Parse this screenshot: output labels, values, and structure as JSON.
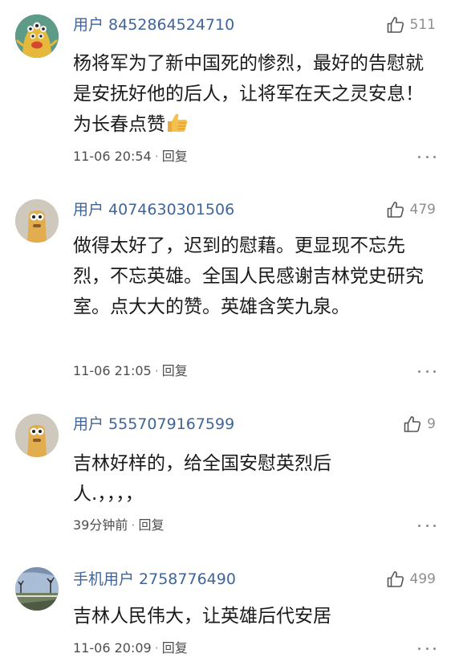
{
  "comments": [
    {
      "username": "用户 8452864524710",
      "likes": "511",
      "text": "杨将军为了新中国死的惨烈，最好的告慰就是安抚好他的后人，让将军在天之灵安息！为长春点赞",
      "time": "11-06 20:54",
      "separator": "·",
      "reply": "回复"
    },
    {
      "username": "用户 4074630301506",
      "likes": "479",
      "text": "做得太好了，迟到的慰藉。更显现不忘先烈，不忘英雄。全国人民感谢吉林党史研究室。点大大的赞。英雄含笑九泉。",
      "time": "11-06 21:05",
      "separator": "·",
      "reply": "回复"
    },
    {
      "username": "用户 5557079167599",
      "likes": "9",
      "text": "吉林好样的，给全国安慰英烈后人.，，，，",
      "time": "39分钟前",
      "separator": "·",
      "reply": "回复"
    },
    {
      "username": "手机用户 2758776490",
      "likes": "499",
      "text": "吉林人民伟大，让英雄后代安居",
      "time": "11-06 20:09",
      "separator": "·",
      "reply": "回复"
    }
  ],
  "icons": {
    "like": "thumbs-up-outline-icon",
    "more": "more-horizontal-icon",
    "emoji": "thumbs-up-emoji"
  },
  "colors": {
    "username": "#406599",
    "body": "#1a1a1a",
    "meta": "#4d4d4d",
    "muted": "#8e8e8e"
  }
}
